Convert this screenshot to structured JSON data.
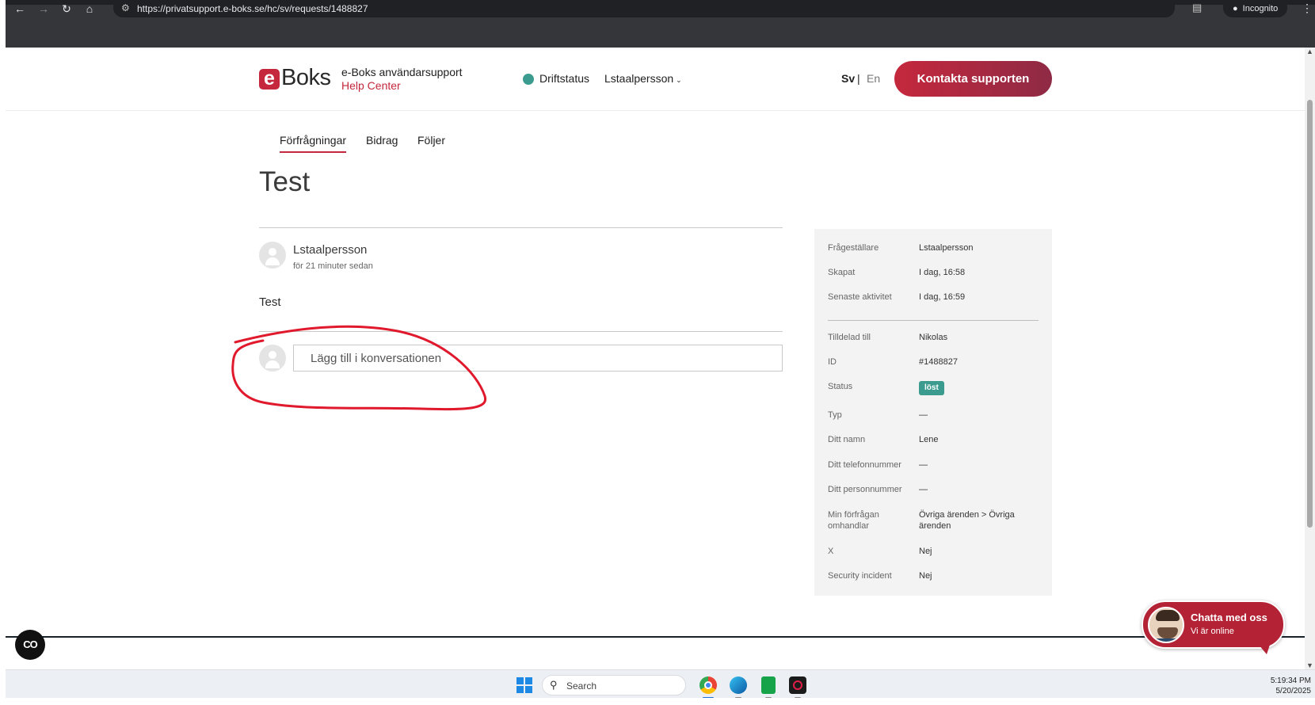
{
  "browser": {
    "url": "https://privatsupport.e-boks.se/hc/sv/requests/1488827",
    "incognito_label": "Incognito"
  },
  "header": {
    "logo_letter": "e",
    "logo_word": "Boks",
    "brand_title": "e-Boks användarsupport",
    "brand_subtitle": "Help Center",
    "status_label": "Driftstatus",
    "user_name": "Lstaalpersson",
    "lang_sv": "Sv",
    "lang_separator": "|",
    "lang_en": "En",
    "contact_button": "Kontakta supporten"
  },
  "tabs": [
    {
      "label": "Förfrågningar",
      "active": true
    },
    {
      "label": "Bidrag",
      "active": false
    },
    {
      "label": "Följer",
      "active": false
    }
  ],
  "request": {
    "title": "Test",
    "author": "Lstaalpersson",
    "time": "för 21 minuter sedan",
    "comment": "Test",
    "reply_placeholder": "Lägg till i konversationen"
  },
  "details": [
    {
      "label": "Frågeställare",
      "value": "Lstaalpersson"
    },
    {
      "label": "Skapat",
      "value": "I dag, 16:58"
    },
    {
      "label": "Senaste aktivitet",
      "value": "I dag, 16:59"
    },
    {
      "label": "Tilldelad till",
      "value": "Nikolas"
    },
    {
      "label": "ID",
      "value": "#1488827"
    },
    {
      "label": "Status",
      "value": "löst"
    },
    {
      "label": "Typ",
      "value": "—"
    },
    {
      "label": "Ditt namn",
      "value": "Lene"
    },
    {
      "label": "Ditt telefonnummer",
      "value": "—"
    },
    {
      "label": "Ditt personnummer",
      "value": "—"
    },
    {
      "label": "Min förfrågan omhandlar",
      "value": "Övriga ärenden > Övriga ärenden"
    },
    {
      "label": "X",
      "value": "Nej"
    },
    {
      "label": "Security incident",
      "value": "Nej"
    }
  ],
  "chat": {
    "title": "Chatta med oss",
    "subtitle": "Vi är online"
  },
  "cc_button": "CO",
  "taskbar": {
    "search_placeholder": "Search",
    "time": "5:19:34 PM",
    "date": "5/20/2025"
  },
  "colors": {
    "brand_red": "#c5283d",
    "status_green": "#3c9b8f",
    "footer_dark": "#18222b",
    "annotation_red": "#e0192d"
  }
}
